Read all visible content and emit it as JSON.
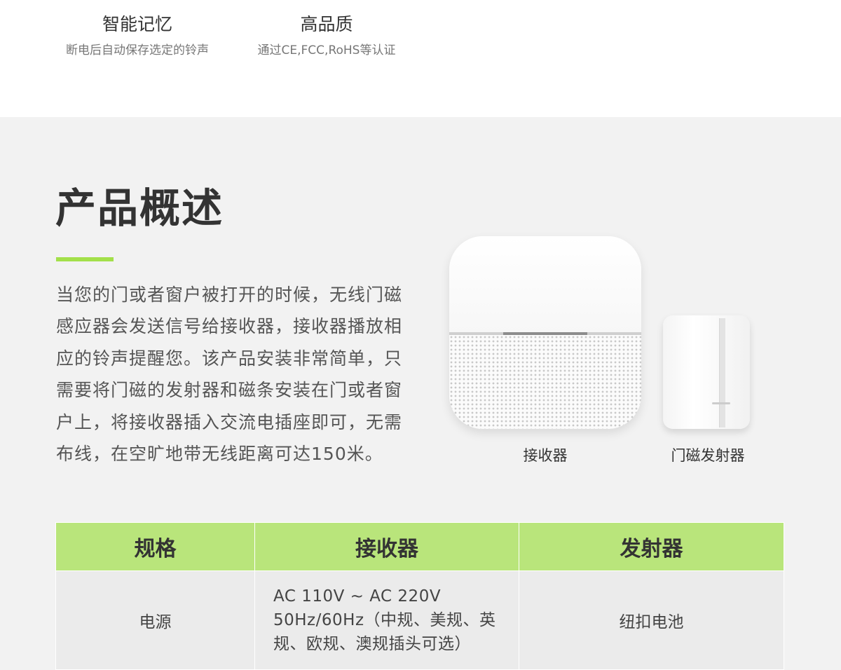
{
  "features": [
    {
      "title": "智能记忆",
      "desc": "断电后自动保存选定的铃声"
    },
    {
      "title": "高品质",
      "desc": "通过CE,FCC,RoHS等认证"
    }
  ],
  "overview": {
    "title": "产品概述",
    "text": "当您的门或者窗户被打开的时候，无线门磁感应器会发送信号给接收器，接收器播放相应的铃声提醒您。该产品安装非常简单，只需要将门磁的发射器和磁条安装在门或者窗户上，将接收器插入交流电插座即可，无需布线，在空旷地带无线距离可达150米。"
  },
  "products": {
    "receiver_label": "接收器",
    "transmitter_label": "门磁发射器"
  },
  "spec_table": {
    "headers": [
      "规格",
      "接收器",
      "发射器"
    ],
    "rows": [
      {
        "spec": "电源",
        "receiver_lines": [
          "AC 110V ~ AC 220V",
          "50Hz/60Hz（中规、美规、英",
          "规、欧规、澳规插头可选）"
        ],
        "transmitter": "纽扣电池"
      }
    ]
  },
  "colors": {
    "accent": "#a3e04a",
    "table_header": "#b9e57b",
    "background": "#f2f2f2"
  }
}
